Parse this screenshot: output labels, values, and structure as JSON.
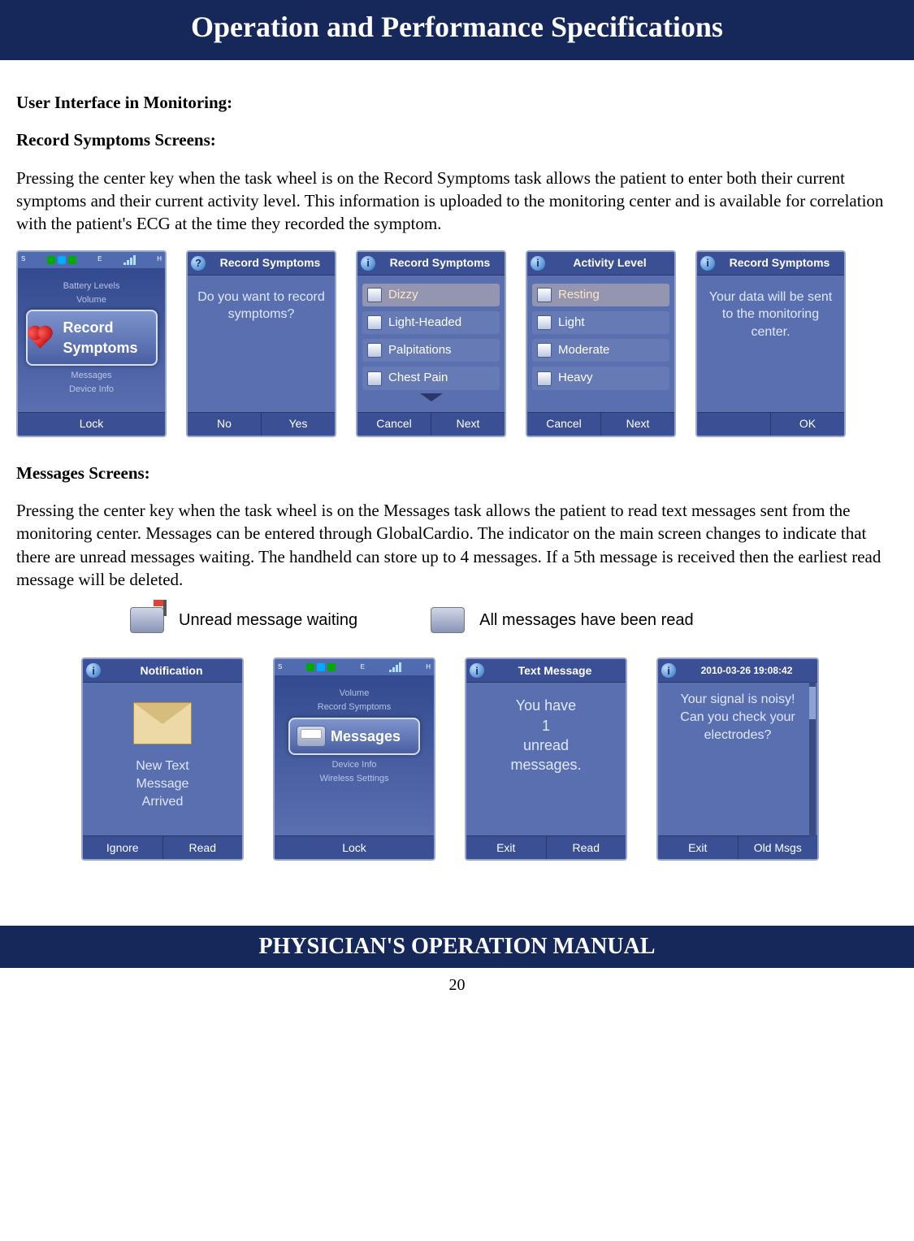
{
  "header": "Operation and Performance Specifications",
  "footer": "PHYSICIAN'S OPERATION MANUAL",
  "page_number": "20",
  "section1": {
    "title": "User Interface in Monitoring:",
    "subtitle": "Record Symptoms Screens:",
    "para": "Pressing the center key when the task wheel is on the Record Symptoms task allows the patient to enter both their current symptoms and their current activity level. This information is uploaded to the monitoring center and is available for correlation with the patient's ECG at the time they recorded the symptom."
  },
  "wheel1": {
    "items": [
      "Battery Levels",
      "Volume"
    ],
    "selected": "Record Symptoms",
    "items_below": [
      "Messages",
      "Device Info"
    ],
    "softkey": "Lock"
  },
  "prompt_screen": {
    "title": "Record Symptoms",
    "body": "Do you want to record symptoms?",
    "left": "No",
    "right": "Yes"
  },
  "symptoms_screen": {
    "title": "Record Symptoms",
    "options": [
      "Dizzy",
      "Light-Headed",
      "Palpitations",
      "Chest Pain"
    ],
    "left": "Cancel",
    "right": "Next"
  },
  "activity_screen": {
    "title": "Activity Level",
    "options": [
      "Resting",
      "Light",
      "Moderate",
      "Heavy"
    ],
    "left": "Cancel",
    "right": "Next"
  },
  "confirm_screen": {
    "title": "Record Symptoms",
    "body": "Your data will be sent to the monitoring center.",
    "right": "OK"
  },
  "section2": {
    "title": "Messages Screens:",
    "para": "Pressing the center key when the task wheel is on the Messages task allows the patient to read text messages sent from the monitoring center. Messages can be entered through GlobalCardio. The indicator on the main screen changes to indicate that there are unread messages waiting. The handheld can store up to 4 messages. If a 5th message is received then the earliest read message will be deleted."
  },
  "legend": {
    "unread": "Unread message waiting",
    "read": "All messages have been read"
  },
  "notif_screen": {
    "title": "Notification",
    "body1": "New Text",
    "body2": "Message",
    "body3": "Arrived",
    "left": "Ignore",
    "right": "Read"
  },
  "wheel2": {
    "items": [
      "Volume",
      "Record Symptoms"
    ],
    "selected": "Messages",
    "items_below": [
      "Device Info",
      "Wireless Settings"
    ],
    "softkey": "Lock"
  },
  "textmsg_screen": {
    "title": "Text Message",
    "line1": "You have",
    "line2": "1",
    "line3": "unread",
    "line4": "messages.",
    "left": "Exit",
    "right": "Read"
  },
  "detail_screen": {
    "title": "2010-03-26 19:08:42",
    "body": "Your signal is noisy! Can you check your electrodes?",
    "left": "Exit",
    "right": "Old Msgs"
  }
}
